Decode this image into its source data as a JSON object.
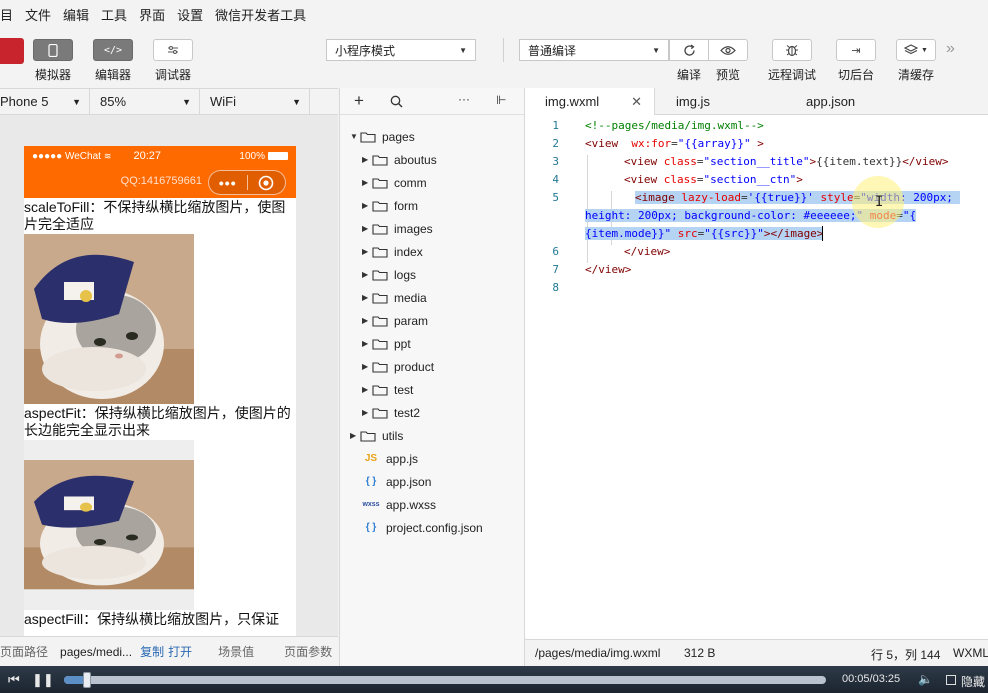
{
  "menu": [
    "目",
    "文件",
    "编辑",
    "工具",
    "界面",
    "设置",
    "微信开发者工具"
  ],
  "toolbar": {
    "simulator": "模拟器",
    "editor": "编辑器",
    "debugger": "调试器",
    "mode_select": "小程序模式",
    "compile_select": "普通编译",
    "compile": "编译",
    "preview": "预览",
    "remote_debug": "远程调试",
    "background": "切后台",
    "clear_cache": "清缓存"
  },
  "devicebar": {
    "device": "Phone 5",
    "zoom": "85%",
    "network": "WiFi"
  },
  "phone": {
    "carrier": "●●●●● WeChat",
    "time": "20:27",
    "battery": "100%",
    "nav_text": "QQ:1416759661",
    "captions": [
      "scaleToFill：不保持纵横比缩放图片，使图片完全适应",
      "aspectFit：保持纵横比缩放图片，使图片的长边能完全显示出来",
      "aspectFill：保持纵横比缩放图片，只保证"
    ]
  },
  "simfooter": {
    "path_label": "页面路径",
    "path": "pages/medi...",
    "copy": "复制",
    "open": "打开",
    "scene": "场景值",
    "params": "页面参数"
  },
  "filetree": {
    "nodes": [
      {
        "label": "pages"
      },
      {
        "label": "aboutus"
      },
      {
        "label": "comm"
      },
      {
        "label": "form"
      },
      {
        "label": "images"
      },
      {
        "label": "index"
      },
      {
        "label": "logs"
      },
      {
        "label": "media"
      },
      {
        "label": "param"
      },
      {
        "label": "ppt"
      },
      {
        "label": "product"
      },
      {
        "label": "test"
      },
      {
        "label": "test2"
      },
      {
        "label": "utils"
      },
      {
        "label": "app.js",
        "badge": "JS"
      },
      {
        "label": "app.json",
        "badge": "{ }"
      },
      {
        "label": "app.wxss",
        "badge": "wxss"
      },
      {
        "label": "project.config.json",
        "badge": "{ }"
      }
    ]
  },
  "editor": {
    "tabs": [
      "img.wxml",
      "img.js",
      "app.json"
    ],
    "line_numbers": [
      "1",
      "2",
      "3",
      "4",
      "5",
      "6",
      "7",
      "8"
    ],
    "tokens": {
      "l1": "<!--pages/media/img.wxml-->",
      "l2a": "<view",
      "l2b": "wx:for",
      "l2c": "=",
      "l2d": "\"{{array}}\"",
      "l2e": " >",
      "l3a": "<view",
      "l3b": "class",
      "l3c": "=",
      "l3d": "\"section__title\"",
      "l3e": ">",
      "l3f": "{{item.text}}",
      "l3g": "</view>",
      "l4a": "<view",
      "l4b": "class",
      "l4c": "=",
      "l4d": "\"section__ctn\"",
      "l4e": ">",
      "l5a": "<image",
      "l5b": "lazy-load",
      "l5c": "=",
      "l5d": "'{{true}}'",
      "l5e": "style",
      "l5f": "=",
      "l5g": "\"width: 200px;",
      "l5h": "height: 200px; background-color: #eeeeee;\"",
      "l5i": "mode",
      "l5j": "=",
      "l5k": "\"{",
      "l5l": "{item.mode}}\"",
      "l5m": "src",
      "l5n": "=",
      "l5o": "\"{{src}}\"",
      "l5p": "></image>",
      "l6": "</view>",
      "l7": "</view>"
    },
    "footer": {
      "path": "/pages/media/img.wxml",
      "size": "312 B",
      "cursor": "行 5，列 144",
      "lang": "WXML"
    }
  },
  "player": {
    "time": "00:05/03:25",
    "hide": "隐藏",
    "progress": 0.03
  }
}
